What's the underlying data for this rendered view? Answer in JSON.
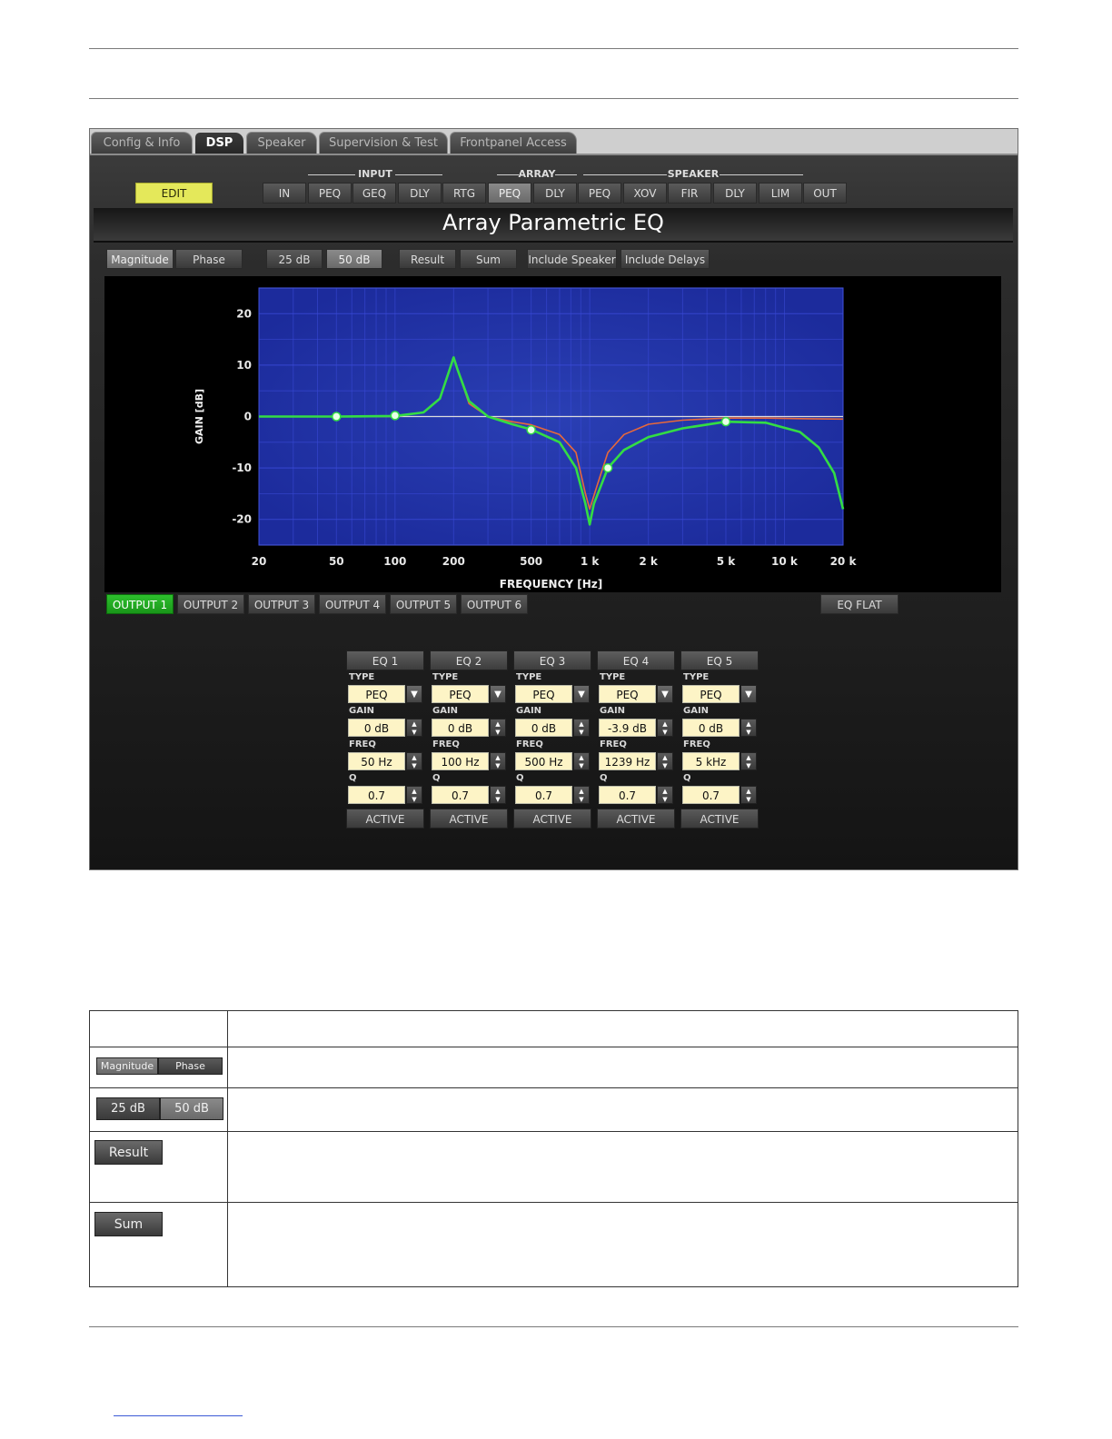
{
  "tabs": [
    "Config & Info",
    "DSP",
    "Speaker",
    "Supervision & Test",
    "Frontpanel Access"
  ],
  "active_tab": "DSP",
  "edit_button": "EDIT",
  "groups": {
    "input": "INPUT",
    "array": "ARRAY",
    "speaker": "SPEAKER"
  },
  "chain_buttons": [
    "IN",
    "PEQ",
    "GEQ",
    "DLY",
    "RTG",
    "PEQ",
    "DLY",
    "PEQ",
    "XOV",
    "FIR",
    "DLY",
    "LIM",
    "OUT"
  ],
  "chain_selected_index": 5,
  "page_title": "Array Parametric EQ",
  "view_buttons": {
    "magnitude": "Magnitude",
    "phase": "Phase",
    "db25": "25 dB",
    "db50": "50 dB",
    "result": "Result",
    "sum": "Sum",
    "include_speaker": "Include Speaker",
    "include_delays": "Include Delays"
  },
  "outputs": [
    "OUTPUT 1",
    "OUTPUT 2",
    "OUTPUT 3",
    "OUTPUT 4",
    "OUTPUT 5",
    "OUTPUT 6"
  ],
  "active_output": "OUTPUT 1",
  "eq_flat": "EQ FLAT",
  "eq_bands": [
    {
      "name": "EQ 1",
      "type": "PEQ",
      "gain": "0 dB",
      "freq": "50 Hz",
      "q": "0.7",
      "active": "ACTIVE"
    },
    {
      "name": "EQ 2",
      "type": "PEQ",
      "gain": "0 dB",
      "freq": "100 Hz",
      "q": "0.7",
      "active": "ACTIVE"
    },
    {
      "name": "EQ 3",
      "type": "PEQ",
      "gain": "0 dB",
      "freq": "500 Hz",
      "q": "0.7",
      "active": "ACTIVE"
    },
    {
      "name": "EQ 4",
      "type": "PEQ",
      "gain": "-3.9 dB",
      "freq": "1239 Hz",
      "q": "0.7",
      "active": "ACTIVE"
    },
    {
      "name": "EQ 5",
      "type": "PEQ",
      "gain": "0 dB",
      "freq": "5 kHz",
      "q": "0.7",
      "active": "ACTIVE"
    }
  ],
  "field_labels": {
    "type": "TYPE",
    "gain": "GAIN",
    "freq": "FREQ",
    "q": "Q"
  },
  "colors": {
    "edit": "#e4e85a",
    "output_active": "#22aa22",
    "field_bg": "#fdf4c6",
    "plot_bg": "#1c2b9c",
    "grid": "#3a4ad8",
    "curve_green": "#33dd44",
    "curve_orange": "#e8683a"
  },
  "chart_data": {
    "type": "line",
    "xlabel": "FREQUENCY [Hz]",
    "ylabel": "GAIN [dB]",
    "x_scale": "log",
    "xlim": [
      20,
      20000
    ],
    "ylim": [
      -25,
      25
    ],
    "xticks": [
      20,
      50,
      100,
      200,
      500,
      1000,
      2000,
      5000,
      10000,
      20000
    ],
    "xtick_labels": [
      "20",
      "50",
      "100",
      "200",
      "500",
      "1 k",
      "2 k",
      "5 k",
      "10 k",
      "20 k"
    ],
    "yticks": [
      20,
      10,
      0,
      -10,
      -20
    ],
    "ytick_labels": [
      "20",
      "10",
      "0",
      "-10",
      "-20"
    ],
    "series": [
      {
        "color": "#33dd44",
        "points": [
          [
            20,
            0
          ],
          [
            50,
            0
          ],
          [
            100,
            0.1
          ],
          [
            140,
            0.8
          ],
          [
            170,
            3.5
          ],
          [
            190,
            9
          ],
          [
            200,
            11.5
          ],
          [
            210,
            9
          ],
          [
            240,
            3
          ],
          [
            300,
            0
          ],
          [
            400,
            -1.5
          ],
          [
            500,
            -2.5
          ],
          [
            700,
            -5
          ],
          [
            850,
            -10
          ],
          [
            950,
            -17
          ],
          [
            1000,
            -21
          ],
          [
            1050,
            -17
          ],
          [
            1239,
            -10
          ],
          [
            1500,
            -6.5
          ],
          [
            2000,
            -4
          ],
          [
            3000,
            -2.3
          ],
          [
            5000,
            -1
          ],
          [
            8000,
            -1.2
          ],
          [
            12000,
            -3
          ],
          [
            15000,
            -6
          ],
          [
            18000,
            -11
          ],
          [
            20000,
            -18
          ]
        ]
      },
      {
        "color": "#e8683a",
        "points": [
          [
            20,
            0
          ],
          [
            50,
            0
          ],
          [
            100,
            0
          ],
          [
            140,
            0.8
          ],
          [
            170,
            3.5
          ],
          [
            190,
            9
          ],
          [
            200,
            11.5
          ],
          [
            210,
            9
          ],
          [
            240,
            2.5
          ],
          [
            300,
            0
          ],
          [
            400,
            -1
          ],
          [
            500,
            -1.6
          ],
          [
            700,
            -3.5
          ],
          [
            850,
            -7
          ],
          [
            950,
            -15
          ],
          [
            1000,
            -18
          ],
          [
            1100,
            -13
          ],
          [
            1239,
            -7
          ],
          [
            1500,
            -3.5
          ],
          [
            2000,
            -1.5
          ],
          [
            3000,
            -0.7
          ],
          [
            5000,
            -0.3
          ],
          [
            8000,
            -0.3
          ],
          [
            12000,
            -0.4
          ],
          [
            20000,
            -0.5
          ]
        ]
      }
    ],
    "markers": [
      [
        50,
        0
      ],
      [
        100,
        0.2
      ],
      [
        500,
        -2.6
      ],
      [
        1239,
        -10
      ],
      [
        5000,
        -1
      ]
    ]
  }
}
